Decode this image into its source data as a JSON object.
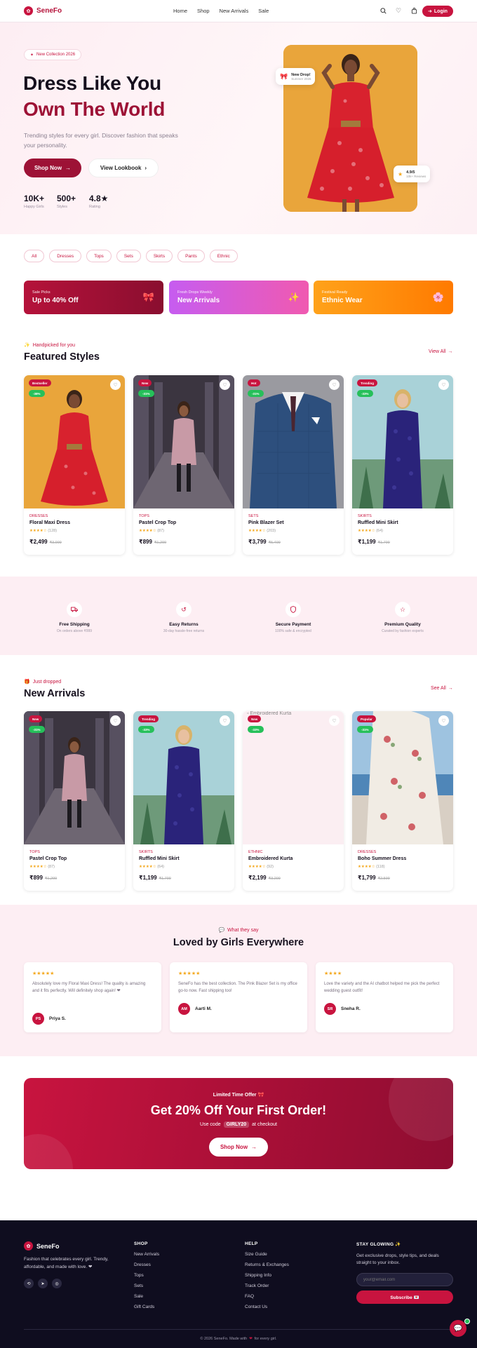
{
  "brand": {
    "name": "SeneFo",
    "accent": "#c8143f",
    "deep": "#9d1236"
  },
  "nav": {
    "links": [
      "Home",
      "Shop",
      "New Arrivals",
      "Sale"
    ],
    "login": "Login",
    "icons": [
      "search-icon",
      "heart-icon",
      "bag-icon"
    ]
  },
  "hero": {
    "badge": "New Collection 2026",
    "title_line1": "Dress Like You",
    "title_line2": "Own The World",
    "subtitle": "Trending styles for every girl. Discover fashion that speaks your personality.",
    "cta_primary": "Shop Now",
    "cta_secondary": "View Lookbook",
    "stats": [
      {
        "value": "10K+",
        "label": "Happy Girls"
      },
      {
        "value": "500+",
        "label": "Styles"
      },
      {
        "value": "4.8★",
        "label": "Rating"
      }
    ],
    "float_top": {
      "title": "New Drop!",
      "sub": "Summer 2026"
    },
    "float_bottom": {
      "title": "4.9/5",
      "sub": "10k+ Reviews"
    }
  },
  "categories": [
    "All",
    "Dresses",
    "Tops",
    "Sets",
    "Skirts",
    "Pants",
    "Ethnic"
  ],
  "promos": [
    {
      "small": "Sale Picks",
      "big": "Up to 40% Off",
      "icon": "bow-icon",
      "colors": [
        "#b5123a",
        "#8a0e2f"
      ]
    },
    {
      "small": "Fresh Drops Weekly",
      "big": "New Arrivals",
      "icon": "sparkle-icon",
      "colors": [
        "#d35cf2",
        "#f05ab0"
      ]
    },
    {
      "small": "Festival Ready",
      "big": "Ethnic Wear",
      "icon": "flower-icon",
      "colors": [
        "#ff9c14",
        "#ff7a00"
      ]
    }
  ],
  "featured": {
    "kicker": "Handpicked for you",
    "title": "Featured Styles",
    "view_all": "View All",
    "products": [
      {
        "tag": "Bestseller",
        "discount": "-38%",
        "category": "DRESSES",
        "name": "Floral Maxi Dress",
        "stars": "★★★★☆",
        "reviews": "(128)",
        "price": "₹2,499",
        "old": "₹3,999"
      },
      {
        "tag": "New",
        "discount": "-31%",
        "category": "TOPS",
        "name": "Pastel Crop Top",
        "stars": "★★★★☆",
        "reviews": "(87)",
        "price": "₹899",
        "old": "₹1,299"
      },
      {
        "tag": "Hot",
        "discount": "-31%",
        "category": "SETS",
        "name": "Pink Blazer Set",
        "stars": "★★★★☆",
        "reviews": "(203)",
        "price": "₹3,799",
        "old": "₹5,499"
      },
      {
        "tag": "Trending",
        "discount": "-33%",
        "category": "SKIRTS",
        "name": "Ruffled Mini Skirt",
        "stars": "★★★★☆",
        "reviews": "(64)",
        "price": "₹1,199",
        "old": "₹1,799"
      }
    ]
  },
  "features": [
    {
      "icon": "truck-icon",
      "title": "Free Shipping",
      "sub": "On orders above ₹999"
    },
    {
      "icon": "return-icon",
      "title": "Easy Returns",
      "sub": "30-day hassle-free returns"
    },
    {
      "icon": "shield-icon",
      "title": "Secure Payment",
      "sub": "100% safe & encrypted"
    },
    {
      "icon": "star-icon",
      "title": "Premium Quality",
      "sub": "Curated by fashion experts"
    }
  ],
  "arrivals": {
    "kicker": "Just dropped",
    "title": "New Arrivals",
    "view_all": "See All",
    "products": [
      {
        "tag": "New",
        "discount": "-31%",
        "category": "TOPS",
        "name": "Pastel Crop Top",
        "stars": "★★★★☆",
        "reviews": "(87)",
        "price": "₹899",
        "old": "₹1,299"
      },
      {
        "tag": "Trending",
        "discount": "-33%",
        "category": "SKIRTS",
        "name": "Ruffled Mini Skirt",
        "stars": "★★★★☆",
        "reviews": "(64)",
        "price": "₹1,199",
        "old": "₹1,799"
      },
      {
        "tag": "New",
        "discount": "-33%",
        "category": "ETHNIC",
        "name": "Embroidered Kurta",
        "stars": "★★★★☆",
        "reviews": "(92)",
        "price": "₹2,199",
        "old": "₹3,299",
        "alt": "Embroidered Kurta"
      },
      {
        "tag": "Popular",
        "discount": "-31%",
        "category": "DRESSES",
        "name": "Boho Summer Dress",
        "stars": "★★★★☆",
        "reviews": "(118)",
        "price": "₹1,799",
        "old": "₹2,599"
      }
    ]
  },
  "testimonials": {
    "kicker": "What they say",
    "title": "Loved by Girls Everywhere",
    "items": [
      {
        "stars": "★★★★★",
        "quote": "Absolutely love my Floral Maxi Dress! The quality is amazing and it fits perfectly. Will definitely shop again! ❤",
        "initials": "PS",
        "name": "Priya S."
      },
      {
        "stars": "★★★★★",
        "quote": "SeneFo has the best collection. The Pink Blazer Set is my office go-to now. Fast shipping too!",
        "initials": "AM",
        "name": "Aarti M."
      },
      {
        "stars": "★★★★",
        "quote": "Love the variety and the AI chatbot helped me pick the perfect wedding guest outfit!",
        "initials": "SR",
        "name": "Sneha R."
      }
    ]
  },
  "offer": {
    "kicker": "Limited Time Offer 🎀",
    "title": "Get 20% Off Your First Order!",
    "code_prefix": "Use code",
    "code": "GIRLY20",
    "code_suffix": "at checkout",
    "cta": "Shop Now"
  },
  "footer": {
    "brand": "SeneFo",
    "about": "Fashion that celebrates every girl. Trendy, affordable, and made with love. ❤",
    "shop_title": "SHOP",
    "shop_links": [
      "New Arrivals",
      "Dresses",
      "Tops",
      "Sets",
      "Sale",
      "Gift Cards"
    ],
    "help_title": "HELP",
    "help_links": [
      "Size Guide",
      "Returns & Exchanges",
      "Shipping Info",
      "Track Order",
      "FAQ",
      "Contact Us"
    ],
    "news_title": "STAY GLOWING ✨",
    "news_text": "Get exclusive drops, style tips, and deals straight to your inbox.",
    "email_placeholder": "your@email.com",
    "subscribe": "Subscribe 💌",
    "copyright_pre": "© 2026 SeneFo. Made with",
    "copyright_post": "for every girl."
  }
}
